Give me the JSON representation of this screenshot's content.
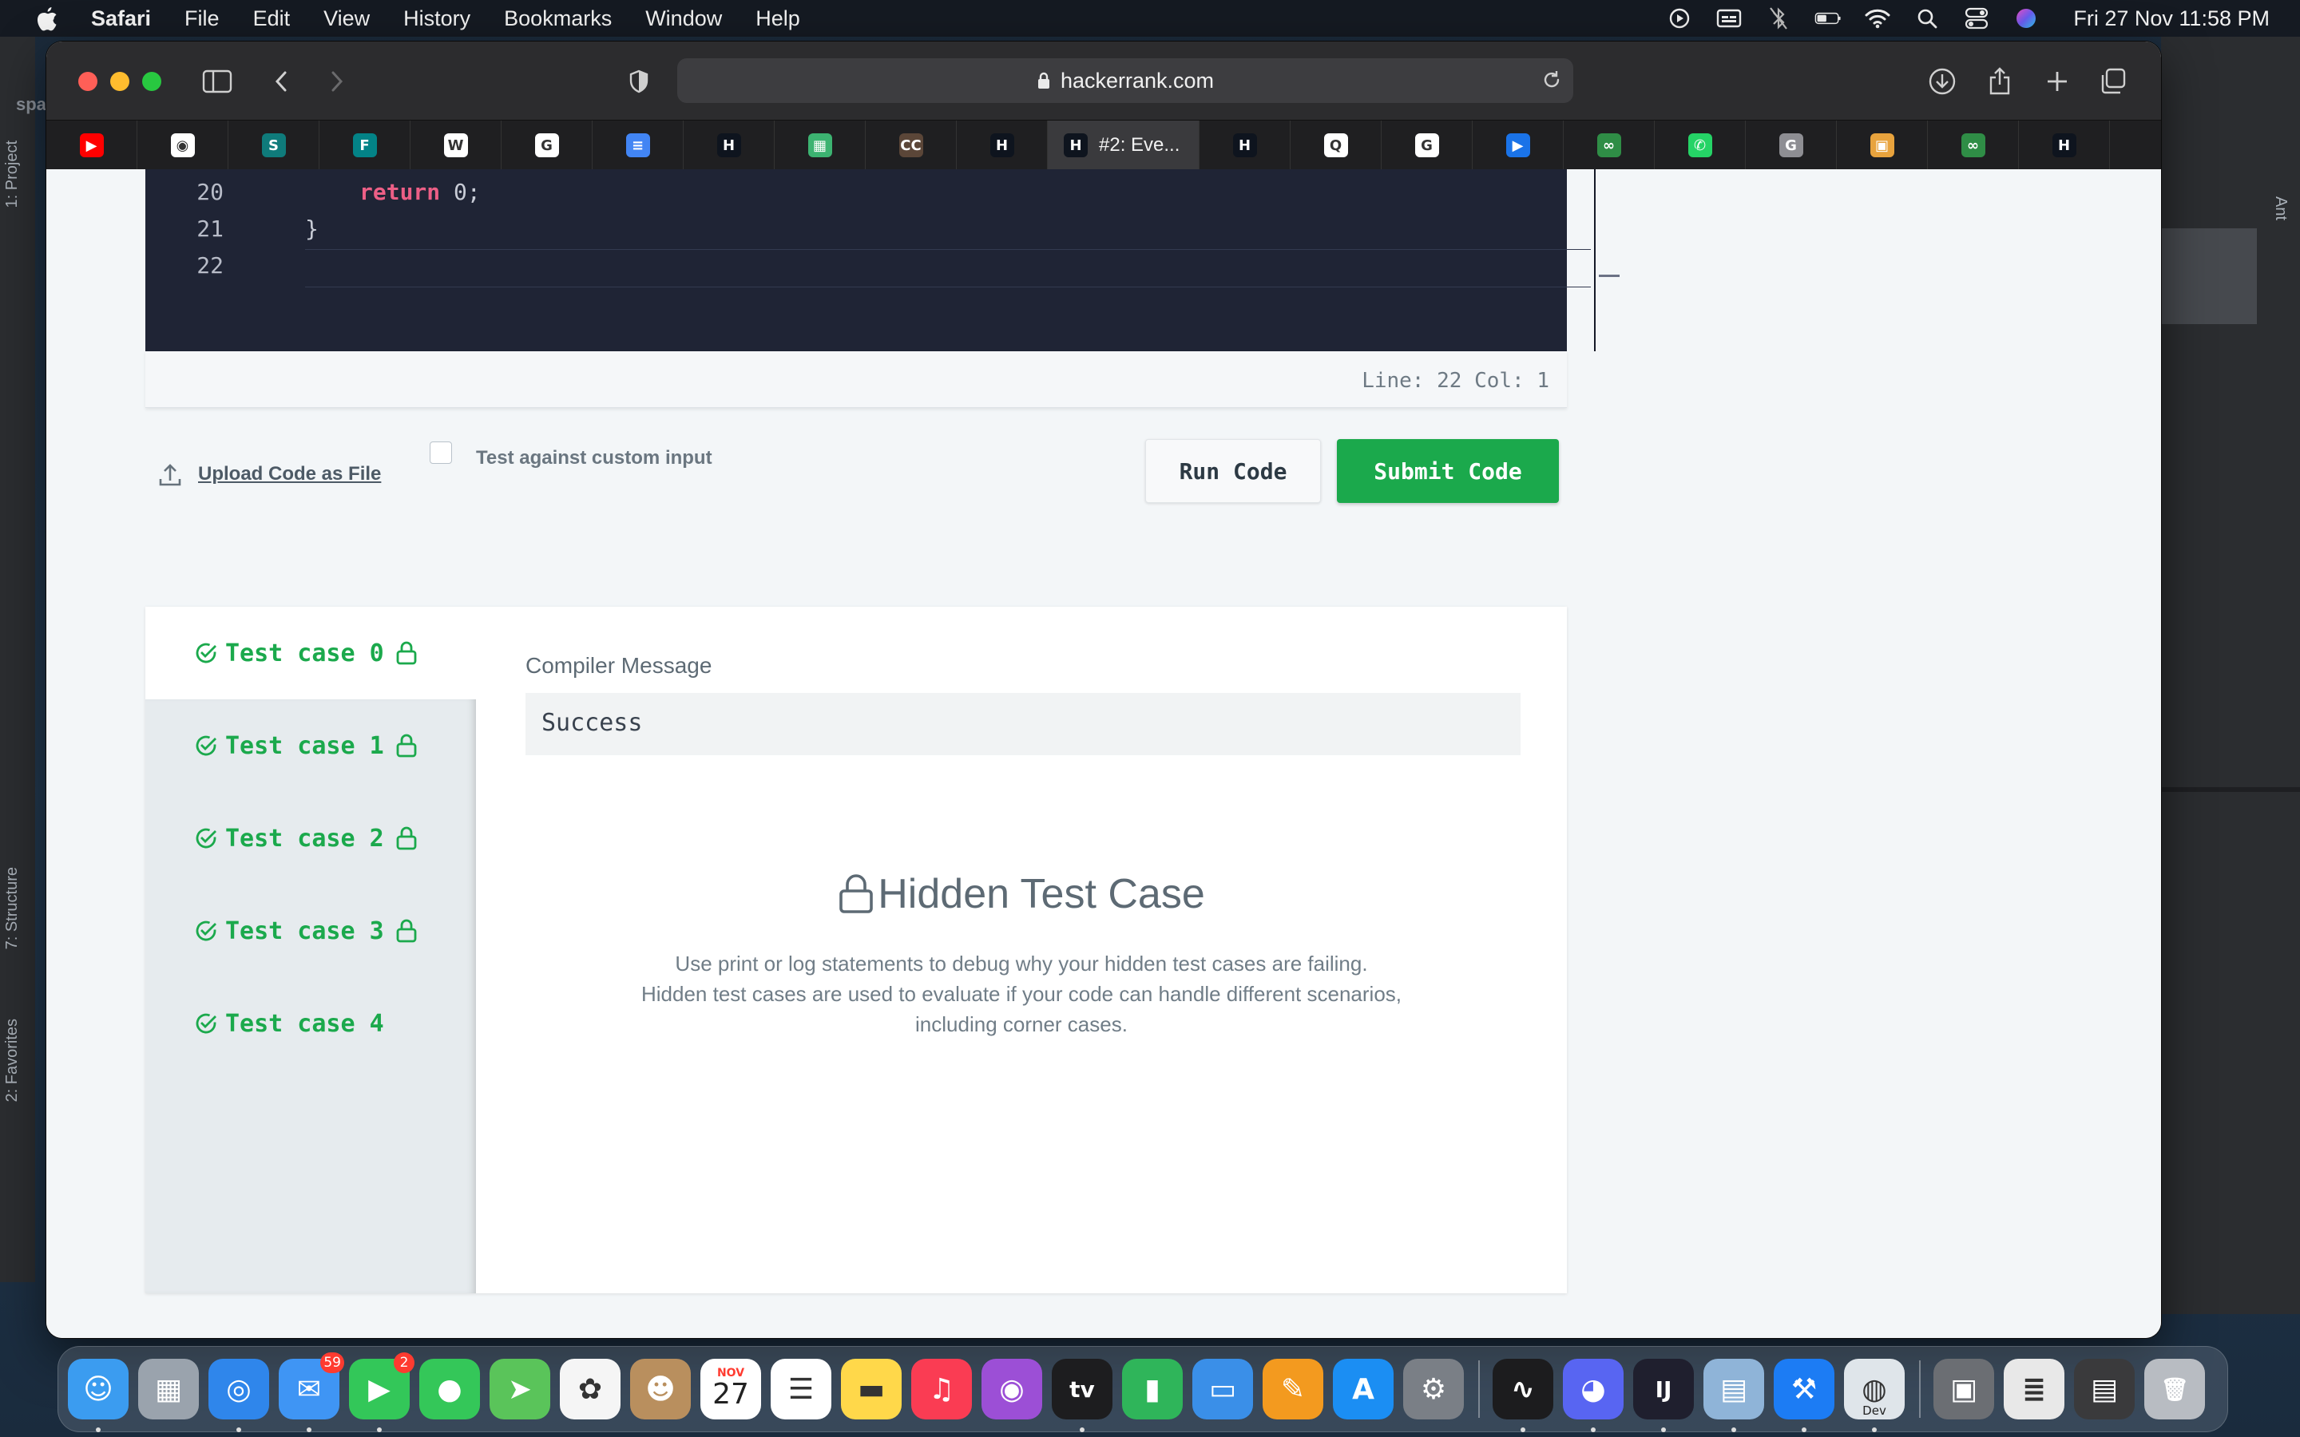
{
  "menubar": {
    "app_name": "Safari",
    "items": [
      "File",
      "Edit",
      "View",
      "History",
      "Bookmarks",
      "Window",
      "Help"
    ],
    "status_icons": [
      "screen-record-icon",
      "caption-icon",
      "bluetooth-off-icon",
      "battery-icon",
      "wifi-icon",
      "spotlight-search-icon",
      "control-center-icon",
      "siri-icon"
    ],
    "clock": "Fri 27 Nov  11:58 PM"
  },
  "background_ide": {
    "left_tabs": [
      "1: Project",
      "7: Structure",
      "2: Favorites"
    ],
    "right_tabs": [
      "Ant"
    ],
    "left_partial_label": "spa"
  },
  "browser": {
    "url": "hackerrank.com",
    "active_tab_title": "#2: Eve...",
    "tabs": [
      {
        "icon": "youtube-icon",
        "color": "#ff0000",
        "glyph": "▶"
      },
      {
        "icon": "github-icon",
        "color": "#ffffff",
        "glyph": "◉"
      },
      {
        "icon": "sharepoint-icon",
        "color": "#0f7b7b",
        "glyph": "S"
      },
      {
        "icon": "forms-icon",
        "color": "#038387",
        "glyph": "F"
      },
      {
        "icon": "wordpress-icon",
        "color": "#ffffff",
        "glyph": "W"
      },
      {
        "icon": "google-icon",
        "color": "#ffffff",
        "glyph": "G"
      },
      {
        "icon": "docs-icon",
        "color": "#4285f4",
        "glyph": "≡"
      },
      {
        "icon": "hackerrank-icon",
        "color": "#0e141e",
        "glyph": "H"
      },
      {
        "icon": "spreadsheet-icon",
        "color": "#3cb371",
        "glyph": "▦"
      },
      {
        "icon": "codechef-icon",
        "color": "#5b4638",
        "glyph": "CC"
      },
      {
        "icon": "hackerrank-icon",
        "color": "#0e141e",
        "glyph": "H"
      },
      {
        "icon": "hackerrank-icon",
        "color": "#0e141e",
        "glyph": "H",
        "active": true
      },
      {
        "icon": "hackerrank-icon",
        "color": "#0e141e",
        "glyph": "H"
      },
      {
        "icon": "quora-icon",
        "color": "#ffffff",
        "glyph": "Q"
      },
      {
        "icon": "google-icon",
        "color": "#ffffff",
        "glyph": "G"
      },
      {
        "icon": "play-icon",
        "color": "#1a73e8",
        "glyph": "▶"
      },
      {
        "icon": "geeksforgeeks-icon",
        "color": "#2f8d46",
        "glyph": "∞"
      },
      {
        "icon": "whatsapp-icon",
        "color": "#25d366",
        "glyph": "✆"
      },
      {
        "icon": "g-icon",
        "color": "#8e8e93",
        "glyph": "G"
      },
      {
        "icon": "image-icon",
        "color": "#e8a33d",
        "glyph": "▣"
      },
      {
        "icon": "geeksforgeeks-icon",
        "color": "#2f8d46",
        "glyph": "∞"
      },
      {
        "icon": "hackerrank-icon",
        "color": "#0e141e",
        "glyph": "H"
      }
    ]
  },
  "editor": {
    "lines": [
      {
        "num": "20",
        "keyword": "return",
        "rest": " 0;"
      },
      {
        "num": "21",
        "text": "}"
      },
      {
        "num": "22",
        "text": ""
      }
    ],
    "status": "Line: 22 Col: 1"
  },
  "actions": {
    "upload_label": "Upload Code as File",
    "custom_input_label": "Test against custom input",
    "custom_input_checked": false,
    "run_label": "Run Code",
    "submit_label": "Submit Code"
  },
  "results": {
    "test_cases": [
      {
        "label": "Test case 0",
        "locked": true,
        "passed": true,
        "active": true
      },
      {
        "label": "Test case 1",
        "locked": true,
        "passed": true
      },
      {
        "label": "Test case 2",
        "locked": true,
        "passed": true
      },
      {
        "label": "Test case 3",
        "locked": true,
        "passed": true
      },
      {
        "label": "Test case 4",
        "locked": false,
        "passed": true
      }
    ],
    "compiler_message_label": "Compiler Message",
    "compiler_message": "Success",
    "hidden_title": "Hidden Test Case",
    "hidden_desc": [
      "Use print or log statements to debug why your hidden test cases are failing.",
      "Hidden test cases are used to evaluate if your code can handle different scenarios,",
      "including corner cases."
    ],
    "accent_color": "#1ba94c"
  },
  "dock": {
    "apps": [
      {
        "name": "finder-icon",
        "color": "#3b9cf0",
        "glyph": "☺",
        "running": true
      },
      {
        "name": "launchpad-icon",
        "color": "#9aa3ad",
        "glyph": "▦"
      },
      {
        "name": "safari-icon",
        "color": "#2f86eb",
        "glyph": "◎",
        "running": true
      },
      {
        "name": "mail-icon",
        "color": "#3f95f4",
        "glyph": "✉",
        "badge": "59",
        "running": true
      },
      {
        "name": "facetime-icon",
        "color": "#33c759",
        "glyph": "▶",
        "badge": "2",
        "running": true
      },
      {
        "name": "messages-icon",
        "color": "#34c759",
        "glyph": "●"
      },
      {
        "name": "maps-icon",
        "color": "#5ac45a",
        "glyph": "➤"
      },
      {
        "name": "photos-icon",
        "color": "#f5f5f5",
        "glyph": "✿"
      },
      {
        "name": "contacts-icon",
        "color": "#b98f5e",
        "glyph": "☻"
      },
      {
        "name": "calendar-icon",
        "color": "#ffffff",
        "glyph": "27",
        "top_text": "NOV"
      },
      {
        "name": "reminders-icon",
        "color": "#ffffff",
        "glyph": "☰"
      },
      {
        "name": "notes-icon",
        "color": "#ffd84a",
        "glyph": "▬"
      },
      {
        "name": "music-icon",
        "color": "#fa3c53",
        "glyph": "♫"
      },
      {
        "name": "podcasts-icon",
        "color": "#9c4fd6",
        "glyph": "◉"
      },
      {
        "name": "tv-icon",
        "color": "#1d1d1f",
        "glyph": "tv",
        "running": true
      },
      {
        "name": "numbers-icon",
        "color": "#2fb55a",
        "glyph": "▮"
      },
      {
        "name": "keynote-icon",
        "color": "#3a8fe8",
        "glyph": "▭"
      },
      {
        "name": "pages-icon",
        "color": "#f39a1f",
        "glyph": "✎"
      },
      {
        "name": "app-store-icon",
        "color": "#1b8ef3",
        "glyph": "A"
      },
      {
        "name": "system-preferences-icon",
        "color": "#7a7f86",
        "glyph": "⚙"
      },
      {
        "separator": true
      },
      {
        "name": "activity-monitor-icon",
        "color": "#1c1c1e",
        "glyph": "∿",
        "running": true
      },
      {
        "name": "discord-icon",
        "color": "#5865f2",
        "glyph": "◕",
        "running": true
      },
      {
        "name": "intellij-icon",
        "color": "#1f1f2e",
        "glyph": "IJ",
        "running": true
      },
      {
        "name": "preview-icon",
        "color": "#8fb4d8",
        "glyph": "▤",
        "running": true
      },
      {
        "name": "xcode-icon",
        "color": "#1c7cf4",
        "glyph": "⚒",
        "running": true
      },
      {
        "name": "chrome-dev-icon",
        "color": "#dfe5ea",
        "glyph": "◍",
        "label": "Dev",
        "running": true
      },
      {
        "separator": true
      },
      {
        "name": "recent-window-icon",
        "color": "#6b6e73",
        "glyph": "▣"
      },
      {
        "name": "recent-document-icon",
        "color": "#e8e8e8",
        "glyph": "≣"
      },
      {
        "name": "recent-window-icon",
        "color": "#3a3a3c",
        "glyph": "▤"
      },
      {
        "name": "trash-icon",
        "color": "#b8bcc2",
        "glyph": "🗑"
      }
    ]
  }
}
